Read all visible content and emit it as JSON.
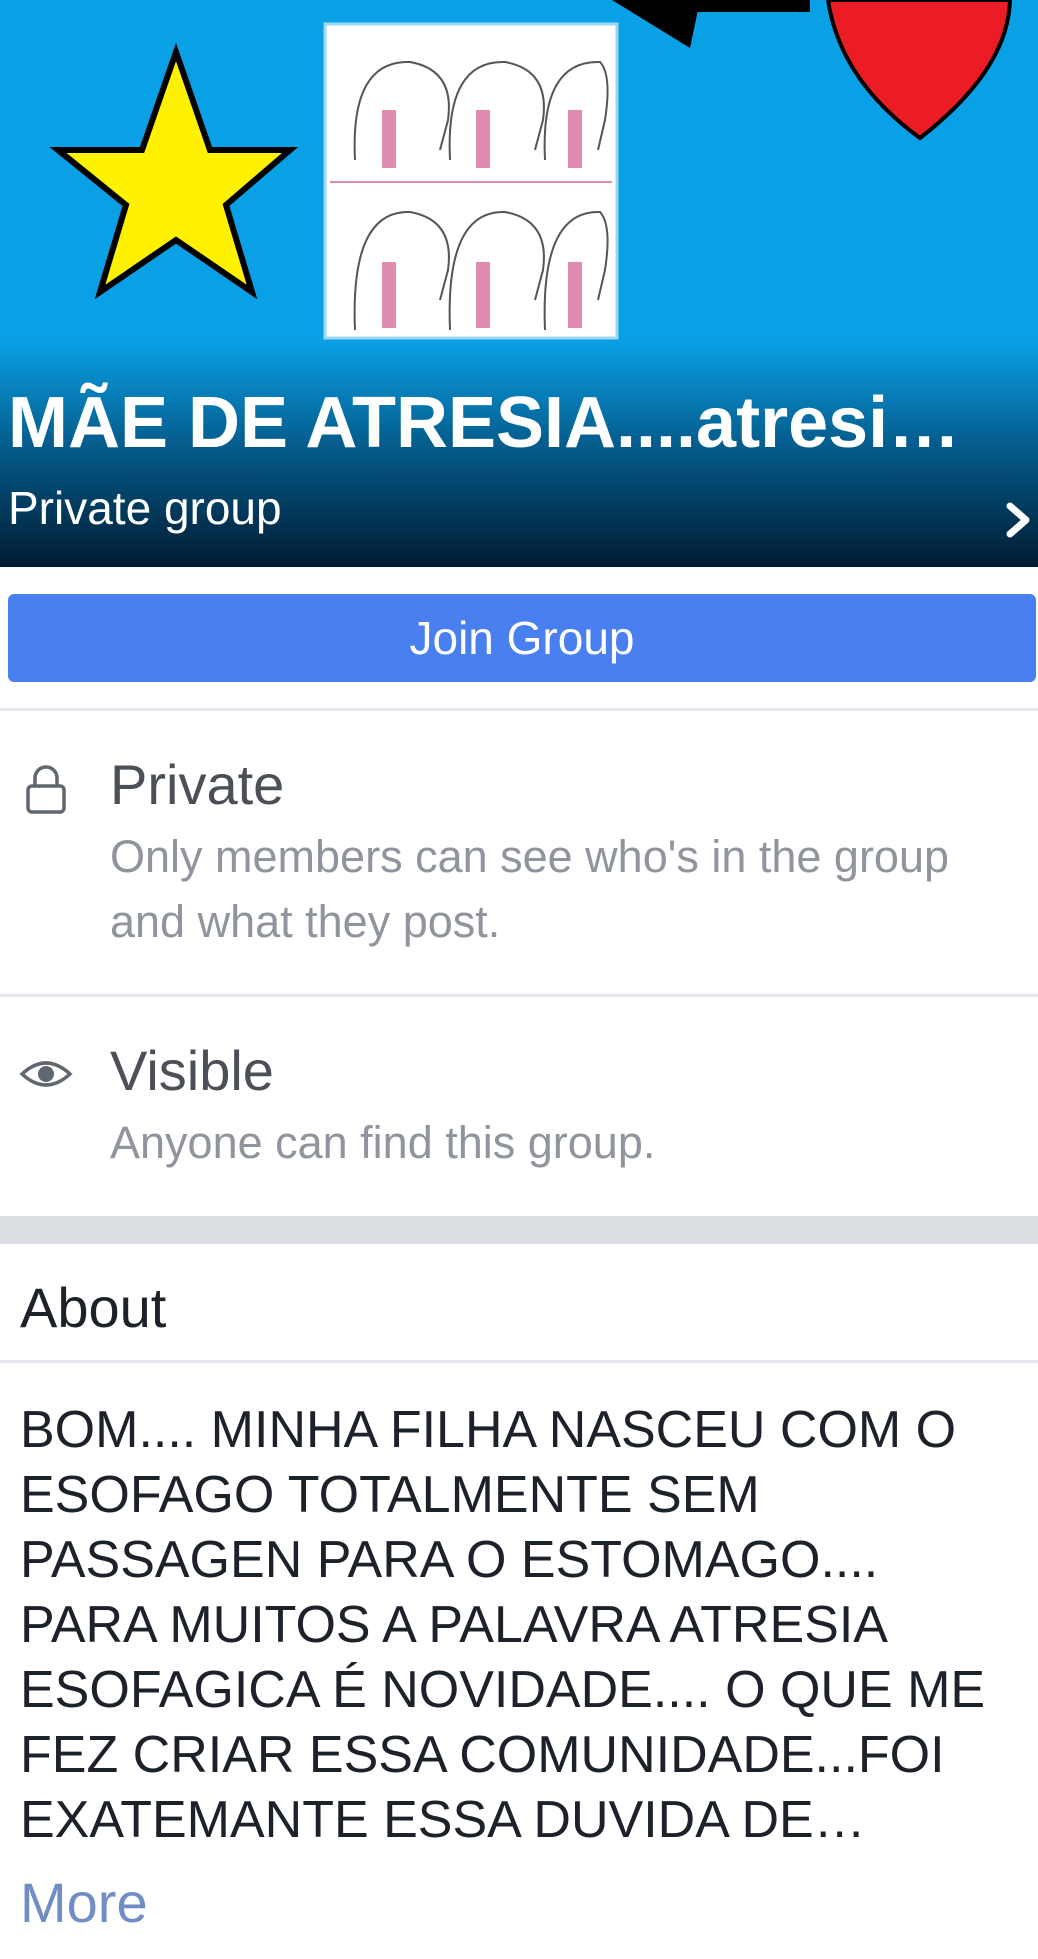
{
  "group": {
    "title": "MÃE DE ATRESIA....atresia …",
    "type": "Private group"
  },
  "actions": {
    "join_label": "Join Group"
  },
  "privacy": {
    "title": "Private",
    "desc_line1": "Only members can see who's in the group",
    "desc_line2": "and what they post."
  },
  "visibility": {
    "title": "Visible",
    "desc": "Anyone can find this group."
  },
  "about": {
    "heading": "About",
    "lines": [
      "BOM.... MINHA FILHA NASCEU COM O",
      "ESOFAGO TOTALMENTE SEM",
      "PASSAGEN PARA O ESTOMAGO....",
      "PARA MUITOS A PALAVRA ATRESIA",
      "ESOFAGICA É NOVIDADE.... O QUE ME",
      "FEZ CRIAR ESSA COMUNIDADE...FOI",
      "EXATEMANTE ESSA DUVIDA DE…"
    ],
    "more_label": "More"
  },
  "icons": {
    "lock": "lock-icon",
    "eye": "eye-icon",
    "chevron": "chevron-right-icon"
  },
  "colors": {
    "cover_bg": "#0aa0e6",
    "join_button": "#4a7ff0",
    "link": "#4267b2"
  }
}
